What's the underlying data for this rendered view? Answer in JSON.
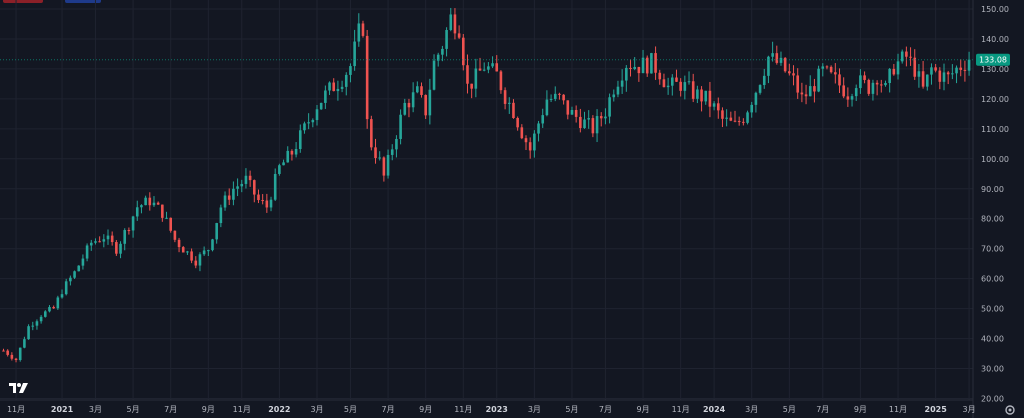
{
  "colors": {
    "background": "#131722",
    "grid": "#1f2330",
    "up": "#26a69a",
    "down": "#ef5350",
    "price_badge": "#089981",
    "text": "#b2b5be"
  },
  "icons": {
    "logo": "tradingview-logo-icon",
    "settings": "gear-icon"
  },
  "current_price": {
    "label": "133.08",
    "value": 133.08
  },
  "chart_data": {
    "type": "candlestick",
    "ylim": [
      20,
      153
    ],
    "y_ticks": [
      "150.00",
      "140.00",
      "130.00",
      "120.00",
      "110.00",
      "100.00",
      "90.00",
      "80.00",
      "70.00",
      "60.00",
      "50.00",
      "40.00",
      "30.00",
      "20.00"
    ],
    "x_labels": [
      {
        "label": "11月",
        "i": 3,
        "year": false
      },
      {
        "label": "2021",
        "i": 14,
        "year": true
      },
      {
        "label": "3月",
        "i": 22,
        "year": false
      },
      {
        "label": "5月",
        "i": 31,
        "year": false
      },
      {
        "label": "7月",
        "i": 40,
        "year": false
      },
      {
        "label": "9月",
        "i": 49,
        "year": false
      },
      {
        "label": "11月",
        "i": 57,
        "year": false
      },
      {
        "label": "2022",
        "i": 66,
        "year": true
      },
      {
        "label": "3月",
        "i": 75,
        "year": false
      },
      {
        "label": "5月",
        "i": 83,
        "year": false
      },
      {
        "label": "7月",
        "i": 92,
        "year": false
      },
      {
        "label": "9月",
        "i": 101,
        "year": false
      },
      {
        "label": "11月",
        "i": 110,
        "year": false
      },
      {
        "label": "2023",
        "i": 118,
        "year": true
      },
      {
        "label": "3月",
        "i": 127,
        "year": false
      },
      {
        "label": "5月",
        "i": 136,
        "year": false
      },
      {
        "label": "7月",
        "i": 144,
        "year": false
      },
      {
        "label": "9月",
        "i": 153,
        "year": false
      },
      {
        "label": "11月",
        "i": 162,
        "year": false
      },
      {
        "label": "2024",
        "i": 170,
        "year": true
      },
      {
        "label": "3月",
        "i": 179,
        "year": false
      },
      {
        "label": "5月",
        "i": 188,
        "year": false
      },
      {
        "label": "7月",
        "i": 196,
        "year": false
      },
      {
        "label": "9月",
        "i": 205,
        "year": false
      },
      {
        "label": "11月",
        "i": 214,
        "year": false
      },
      {
        "label": "2025",
        "i": 223,
        "year": true
      },
      {
        "label": "3月",
        "i": 231,
        "year": false
      }
    ],
    "candles": []
  }
}
